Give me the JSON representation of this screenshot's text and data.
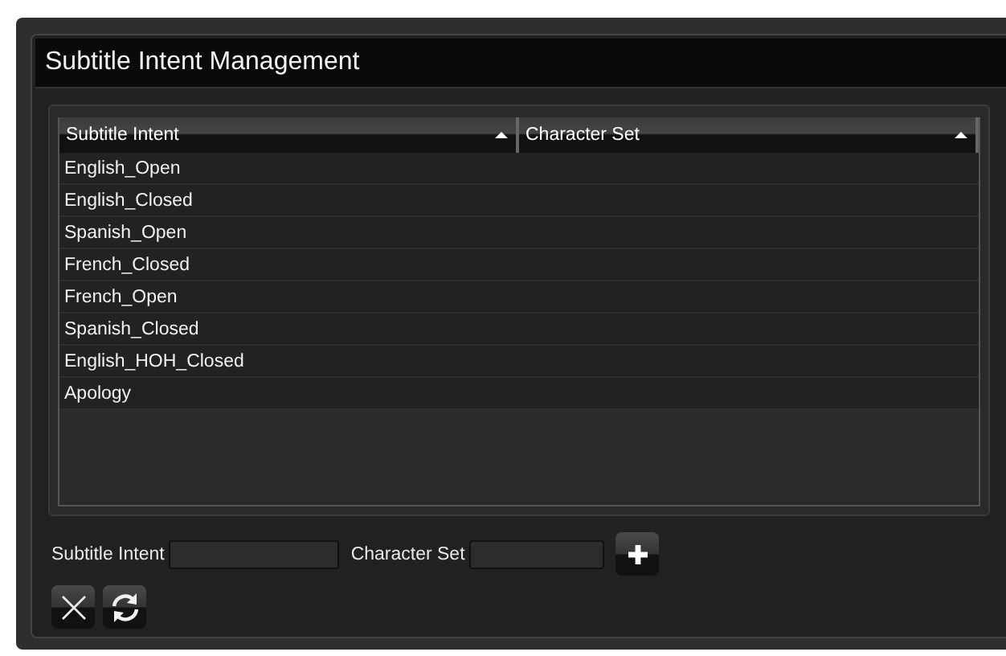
{
  "window": {
    "title": "Subtitle Intent Management"
  },
  "table": {
    "columns": [
      {
        "label": "Subtitle Intent",
        "sorted": true
      },
      {
        "label": "Character Set",
        "sorted": true
      }
    ],
    "rows": [
      {
        "cells": [
          "English_Open",
          ""
        ]
      },
      {
        "cells": [
          "English_Closed",
          ""
        ]
      },
      {
        "cells": [
          "Spanish_Open",
          ""
        ]
      },
      {
        "cells": [
          "French_Closed",
          ""
        ]
      },
      {
        "cells": [
          "French_Open",
          ""
        ]
      },
      {
        "cells": [
          "Spanish_Closed",
          ""
        ]
      },
      {
        "cells": [
          "English_HOH_Closed",
          ""
        ]
      },
      {
        "cells": [
          "Apology",
          ""
        ]
      }
    ]
  },
  "form": {
    "fields": [
      {
        "label": "Subtitle Intent"
      },
      {
        "label": "Character Set"
      }
    ]
  }
}
